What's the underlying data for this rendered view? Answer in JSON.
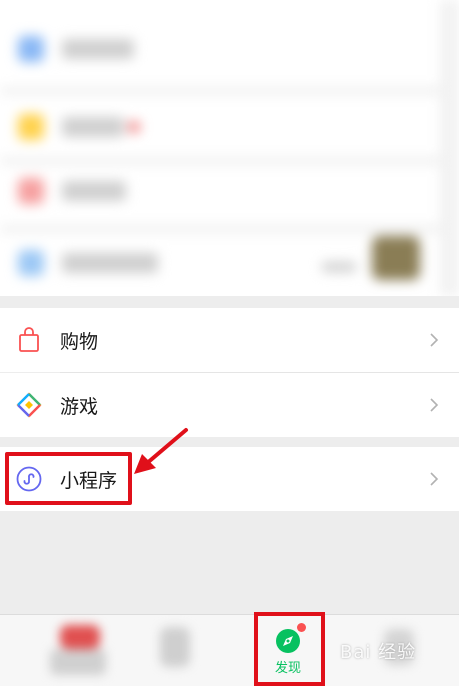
{
  "menu": {
    "items": [
      {
        "label": "购物",
        "icon": "shopping-bag-icon",
        "color": "#fa5151"
      },
      {
        "label": "游戏",
        "icon": "game-diamond-icon",
        "color": "#fa9d3b"
      },
      {
        "label": "小程序",
        "icon": "mini-program-icon",
        "color": "#6467f0"
      }
    ]
  },
  "tabbar": {
    "discover_label": "发现",
    "accent": "#07c160",
    "badge_color": "#fa5151"
  },
  "watermark": {
    "text": "Bai 经验"
  },
  "colors": {
    "highlight": "#e0101a",
    "background": "#ededed"
  }
}
